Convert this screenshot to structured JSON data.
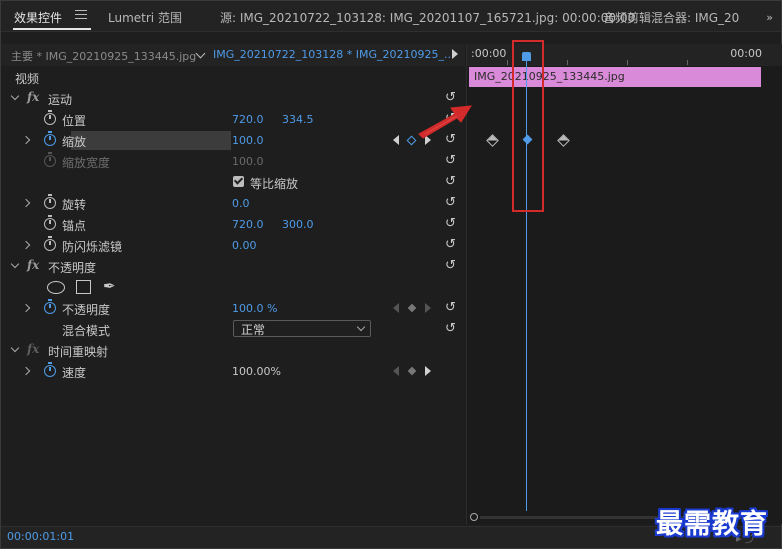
{
  "header": {
    "tab_effect_controls": "效果控件",
    "tab_lumetri": "Lumetri 范围",
    "tab_source": "源: IMG_20210722_103128: IMG_20201107_165721.jpg: 00:00:00:00",
    "tab_audio_mixer": "音频剪辑混合器: IMG_20"
  },
  "source_row": {
    "master": "主要 * IMG_20210925_133445.jpg",
    "clip": "IMG_20210722_103128 * IMG_20210925_..."
  },
  "sections": {
    "video": "视频",
    "motion": "运动",
    "opacity_group": "不透明度",
    "time_remap": "时间重映射"
  },
  "properties": {
    "position": {
      "label": "位置",
      "x": "720.0",
      "y": "334.5"
    },
    "scale": {
      "label": "缩放",
      "value": "100.0"
    },
    "scale_width": {
      "label": "缩放宽度",
      "value": "100.0"
    },
    "uniform_scale": {
      "label": "等比缩放",
      "checked": true
    },
    "rotation": {
      "label": "旋转",
      "value": "0.0"
    },
    "anchor": {
      "label": "锚点",
      "x": "720.0",
      "y": "300.0"
    },
    "anti_flicker": {
      "label": "防闪烁滤镜",
      "value": "0.00"
    },
    "opacity": {
      "label": "不透明度",
      "value": "100.0 %"
    },
    "blend_mode": {
      "label": "混合模式",
      "value": "正常"
    },
    "speed": {
      "label": "速度",
      "value": "100.00%"
    }
  },
  "timeline": {
    "ruler_left": ":00:00",
    "ruler_right": "00:00",
    "clip_name": "IMG_20210925_133445.jpg"
  },
  "footer": {
    "timecode": "00:00:01:01"
  },
  "watermark": "最需教育",
  "colors": {
    "accent": "#4f9be8",
    "clip": "#d98ad8",
    "annotation": "#d32b2b"
  }
}
